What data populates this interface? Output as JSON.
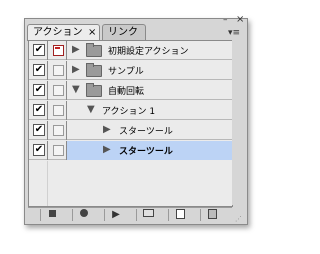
{
  "tabs": [
    {
      "label": "アクション",
      "close": "×"
    },
    {
      "label": "リンク"
    }
  ],
  "window": {
    "minimize": "–",
    "close": "×",
    "panel_menu": "▾≡"
  },
  "rows": [
    {
      "check": "✔",
      "dialog": true,
      "expand": "▶",
      "icon": "folder",
      "label": "初期設定アクション",
      "indent": 0,
      "selected": false
    },
    {
      "check": "✔",
      "dialog": false,
      "expand": "▶",
      "icon": "folder",
      "label": "サンプル",
      "indent": 0,
      "selected": false
    },
    {
      "check": "✔",
      "dialog": false,
      "expand": "▼",
      "icon": "folder",
      "label": "自動回転",
      "indent": 0,
      "selected": false
    },
    {
      "check": "✔",
      "dialog": false,
      "expand": "▼",
      "icon": "",
      "label": "アクション 1",
      "indent": 1,
      "selected": false
    },
    {
      "check": "✔",
      "dialog": false,
      "expand": "▶",
      "icon": "",
      "label": "スターツール",
      "indent": 2,
      "selected": false
    },
    {
      "check": "✔",
      "dialog": false,
      "expand": "▶",
      "icon": "",
      "label": "スターツール",
      "indent": 2,
      "selected": true
    }
  ],
  "toolbar": [
    "stop-icon",
    "record-icon",
    "play-icon",
    "new-set-icon",
    "new-action-icon",
    "delete-icon"
  ],
  "colors": {
    "selection": "#bcd3f5",
    "dialog_marker": "#c02020"
  }
}
